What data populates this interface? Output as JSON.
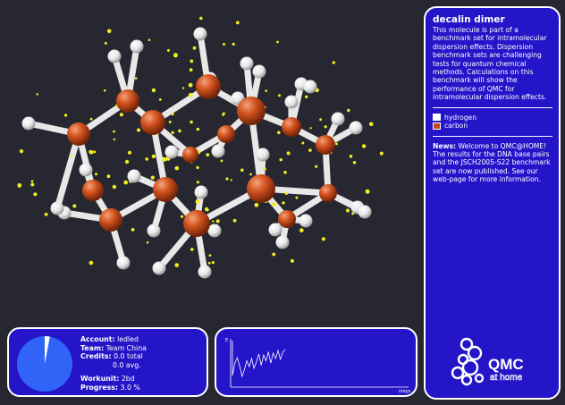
{
  "info": {
    "title": "decalin dimer",
    "description": "This molecule is part of a benchmark set for intramolecular dispersion effects. Dispersion benchmark sets are challenging tests for quantum chemical methods. Calculations on this benchmark will show the performance of QMC for intramolecular dispersion effects.",
    "legend": [
      {
        "label": "hydrogen",
        "color": "#ffffff"
      },
      {
        "label": "carbon",
        "color": "#c8461e"
      }
    ],
    "news_label": "News:",
    "news_text": "Welcome to QMC@HOME! The results for the DNA base pairs and the JSCH2005-S22 benchmark set are now published. See our web-page for more information.",
    "logo_text": "QMC",
    "logo_subtext": "at home"
  },
  "user": {
    "account_label": "Account:",
    "account": "ledled",
    "team_label": "Team:",
    "team": "Team China",
    "credits_label": "Credits:",
    "credits_total": "0.0 total",
    "credits_avg": "0.0 avg.",
    "workunit_label": "Workunit:",
    "workunit": "2bd",
    "progress_label": "Progress:",
    "progress": "3.0 %",
    "progress_fraction": 0.03
  },
  "graph": {
    "x_label": "steps",
    "y_label": "E",
    "values": [
      0.22,
      0.5,
      0.62,
      0.44,
      0.2,
      0.35,
      0.55,
      0.42,
      0.6,
      0.38,
      0.52,
      0.7,
      0.45,
      0.68,
      0.55,
      0.75,
      0.5,
      0.72,
      0.6,
      0.78,
      0.58,
      0.74,
      0.8
    ]
  },
  "colors": {
    "background": "#262731",
    "panel": "#2416c8",
    "carbon": "#c8461e",
    "hydrogen": "#ffffff",
    "particles": "#f2ee22"
  }
}
